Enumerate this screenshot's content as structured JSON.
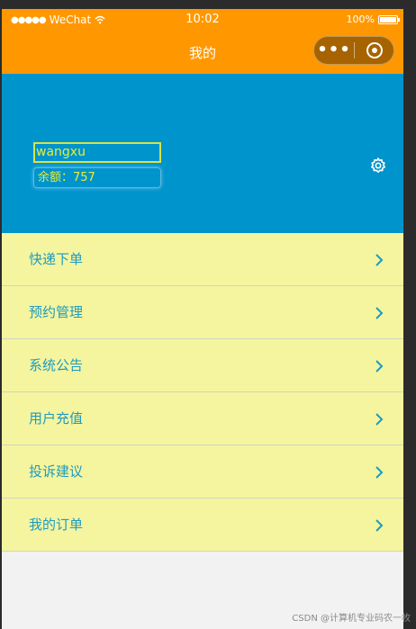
{
  "status_bar": {
    "carrier": "WeChat",
    "time": "10:02",
    "battery": "100%"
  },
  "nav": {
    "title": "我的"
  },
  "profile": {
    "username": "wangxu",
    "balance": "余额：757"
  },
  "menu": [
    {
      "label": "快递下单"
    },
    {
      "label": "预约管理"
    },
    {
      "label": "系统公告"
    },
    {
      "label": "用户充值"
    },
    {
      "label": "投诉建议"
    },
    {
      "label": "我的订单"
    }
  ],
  "watermark": "CSDN @计算机专业码农一枚",
  "colors": {
    "accent": "#ff9800",
    "header_bg": "#0094cc",
    "menu_bg": "#f5f59f",
    "menu_text": "#1e9bbe",
    "profile_text": "#e6ee3c"
  }
}
